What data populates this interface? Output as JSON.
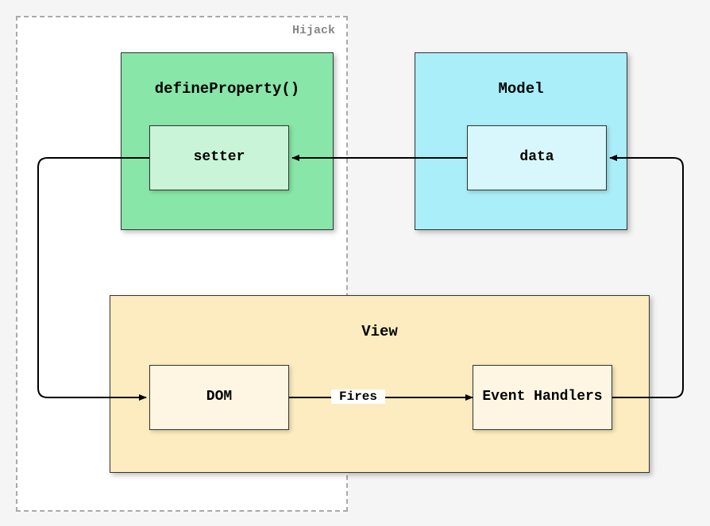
{
  "hijack_label": "Hijack",
  "defineProperty": {
    "title": "defineProperty()",
    "setter": "setter"
  },
  "model": {
    "title": "Model",
    "data": "data"
  },
  "view": {
    "title": "View",
    "dom": "DOM",
    "event_handlers": "Event Handlers",
    "fires_label": "Fires"
  }
}
